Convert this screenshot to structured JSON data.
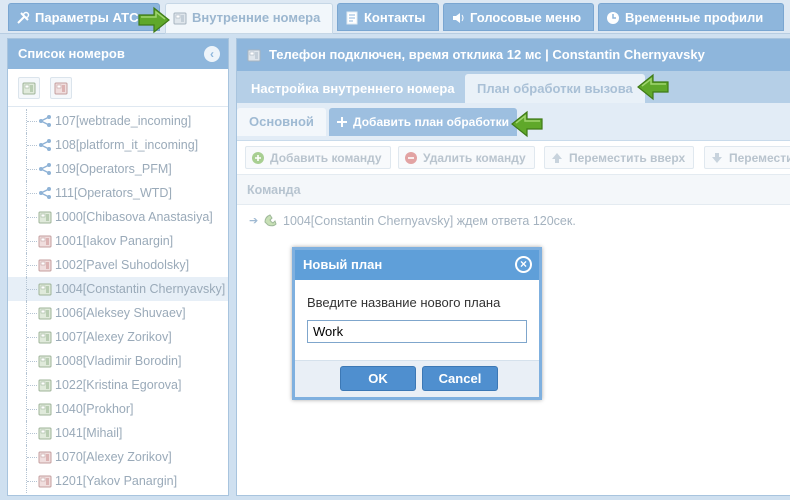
{
  "top_tabs": [
    {
      "label": "Параметры АТС",
      "icon": "tools-icon"
    },
    {
      "label": "Внутренние номера",
      "icon": "phone-icon",
      "active": true
    },
    {
      "label": "Контакты",
      "icon": "contacts-icon"
    },
    {
      "label": "Голосовые меню",
      "icon": "speaker-icon"
    },
    {
      "label": "Временные профили",
      "icon": "clock-icon"
    }
  ],
  "left_panel": {
    "title": "Список номеров",
    "items": [
      {
        "label": "107[webtrade_incoming]",
        "type": "queue"
      },
      {
        "label": "108[platform_it_incoming]",
        "type": "queue"
      },
      {
        "label": "109[Operators_PFM]",
        "type": "queue"
      },
      {
        "label": "111[Operators_WTD]",
        "type": "queue"
      },
      {
        "label": "1000[Chibasova Anastasiya]",
        "type": "phone-ok"
      },
      {
        "label": "1001[Iakov Panargin]",
        "type": "phone-off"
      },
      {
        "label": "1002[Pavel Suhodolsky]",
        "type": "phone-off"
      },
      {
        "label": "1004[Constantin Chernyavsky]",
        "type": "phone-ok",
        "selected": true
      },
      {
        "label": "1006[Aleksey Shuvaev]",
        "type": "phone-ok"
      },
      {
        "label": "1007[Alexey Zorikov]",
        "type": "phone-ok"
      },
      {
        "label": "1008[Vladimir Borodin]",
        "type": "phone-ok"
      },
      {
        "label": "1022[Kristina Egorova]",
        "type": "phone-ok"
      },
      {
        "label": "1040[Prokhor]",
        "type": "phone-ok"
      },
      {
        "label": "1041[Mihail]",
        "type": "phone-ok"
      },
      {
        "label": "1070[Alexey Zorikov]",
        "type": "phone-off"
      },
      {
        "label": "1201[Yakov Panargin]",
        "type": "phone-off"
      }
    ]
  },
  "right_panel": {
    "status": "Телефон подключен, время отклика 12 мс | Constantin Chernyavsky",
    "sub_tabs": [
      "Настройка внутреннего номера",
      "План обработки вызова"
    ],
    "plan_tab": "Основной",
    "add_plan": "Добавить план обработки",
    "commands_toolbar": {
      "add": "Добавить команду",
      "delete": "Удалить команду",
      "up": "Переместить вверх",
      "down": "Переместить вниз"
    },
    "column_header": "Команда",
    "command_row": "1004[Constantin Chernyavsky] ждем ответа 120сек."
  },
  "dialog": {
    "title": "Новый план",
    "label": "Введите название нового плана",
    "input_value": "Work",
    "ok": "OK",
    "cancel": "Cancel"
  },
  "colors": {
    "header_blue": "#8eb6dc",
    "dialog_blue": "#5f9fd9",
    "button_blue": "#4f8fcf",
    "arrow_green": "#5fa82a"
  }
}
